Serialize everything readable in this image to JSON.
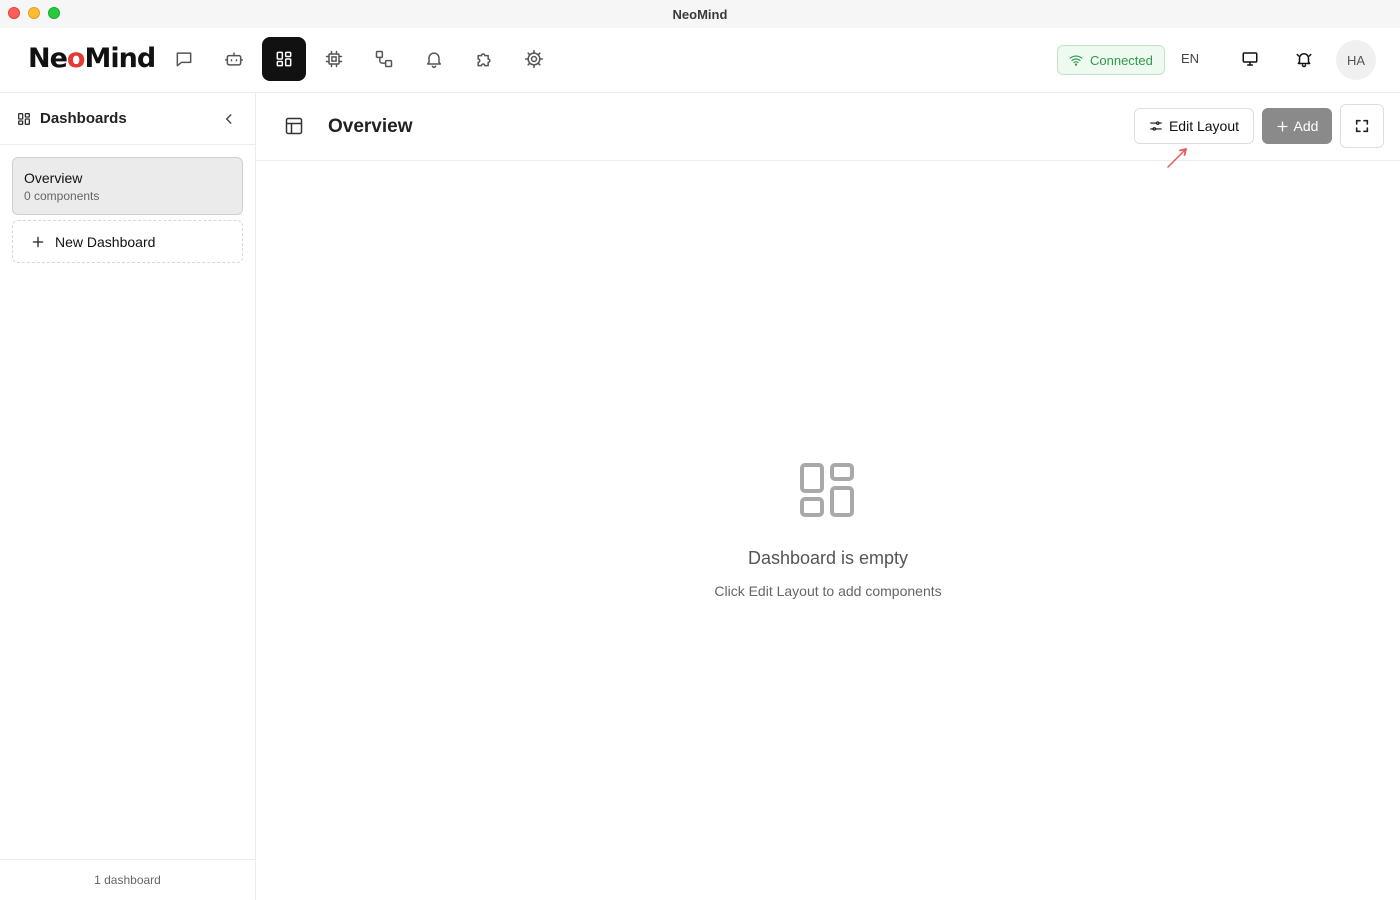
{
  "window": {
    "title": "NeoMind"
  },
  "brand": {
    "logo_prefix": "Ne",
    "logo_o": "o",
    "logo_suffix": "Mind",
    "accent": "#e53935"
  },
  "nav": {
    "icons": [
      "chat-icon",
      "bot-icon",
      "dashboard-icon",
      "chip-icon",
      "workflow-icon",
      "bell-icon",
      "puzzle-icon",
      "settings-icon"
    ],
    "active": "dashboard-icon"
  },
  "header": {
    "status": "Connected",
    "status_color": "#2e9b48",
    "language": "EN",
    "avatar_initials": "HA"
  },
  "sidebar": {
    "title": "Dashboards",
    "dashboards": [
      {
        "name": "Overview",
        "subtitle": "0 components"
      }
    ],
    "new_label": "New Dashboard",
    "footer": "1 dashboard"
  },
  "main": {
    "title": "Overview",
    "edit_label": "Edit Layout",
    "add_label": "Add",
    "empty_title": "Dashboard is empty",
    "empty_subtitle": "Click Edit Layout to add components"
  }
}
